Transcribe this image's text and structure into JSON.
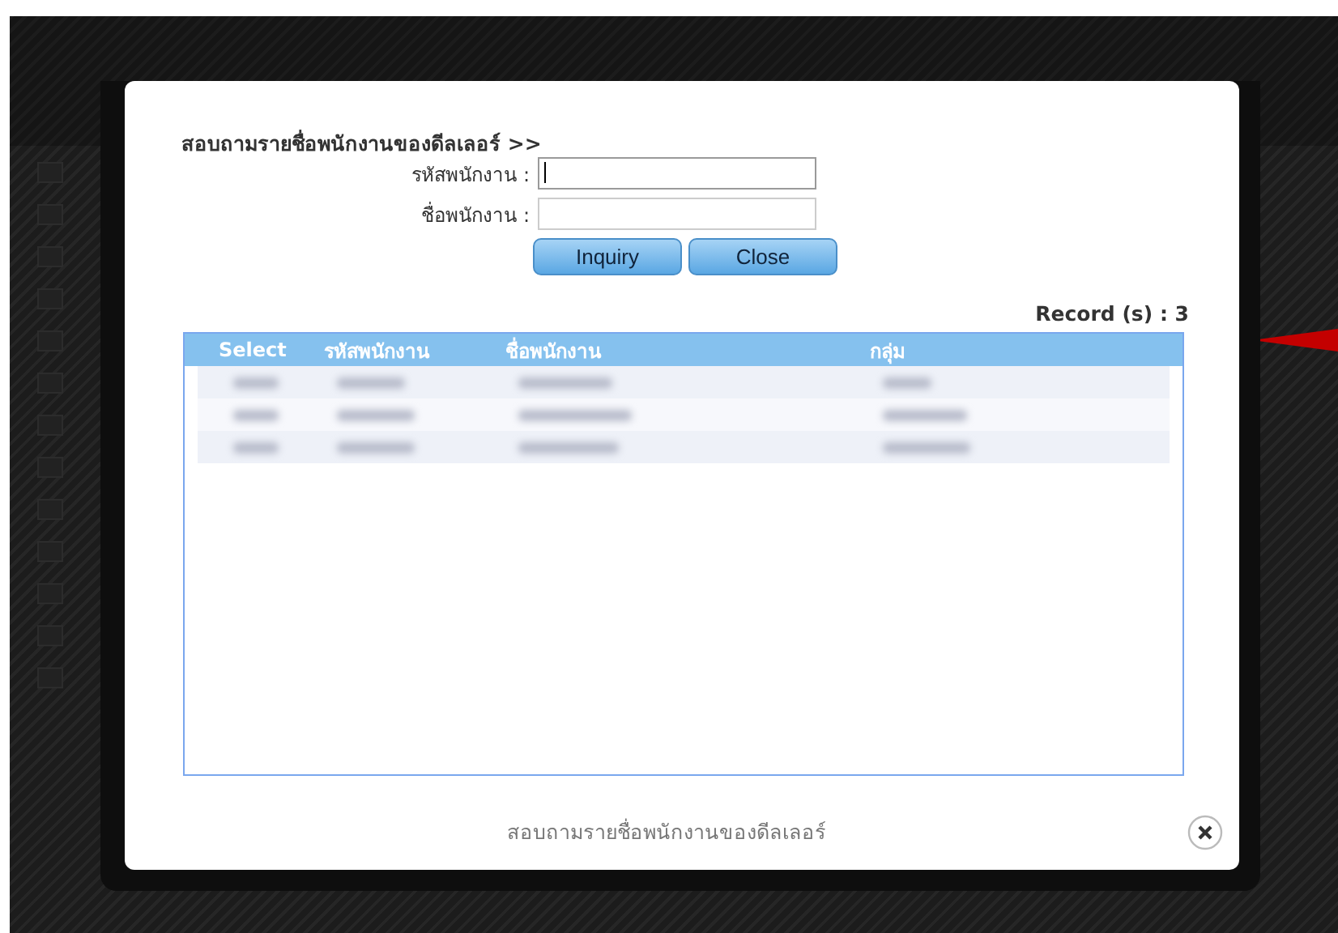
{
  "background_page": {
    "sidebar_icon_count_rows": [
      {
        "kind": "icon"
      },
      {
        "kind": "icon"
      },
      {
        "kind": "icon"
      },
      {
        "kind": "icon"
      },
      {
        "kind": "icon"
      },
      {
        "kind": "icon"
      },
      {
        "kind": "icon"
      },
      {
        "kind": "icon"
      },
      {
        "kind": "icon"
      },
      {
        "kind": "icon"
      },
      {
        "kind": "icon"
      },
      {
        "kind": "icon"
      },
      {
        "kind": "icon"
      }
    ]
  },
  "dialog": {
    "title": "สอบถามรายชื่อพนักงานของดีลเลอร์ >>",
    "fields": [
      {
        "label": "รหัสพนักงาน :",
        "focused": true
      },
      {
        "label": "ชื่อพนักงาน :",
        "focused": false
      }
    ],
    "buttons": [
      "Inquiry",
      "Close"
    ],
    "record_count": "Record (s) : 3",
    "table": {
      "columns": [
        "Select",
        "รหัสพนักงาน",
        "ชื่อพนักงาน",
        "กลุ่ม"
      ],
      "rows": [
        {
          "kind": "redacted"
        },
        {
          "kind": "redacted"
        },
        {
          "kind": "redacted"
        }
      ]
    },
    "footer_caption": "สอบถามรายชื่อพนักงานของดีลเลอร์"
  }
}
